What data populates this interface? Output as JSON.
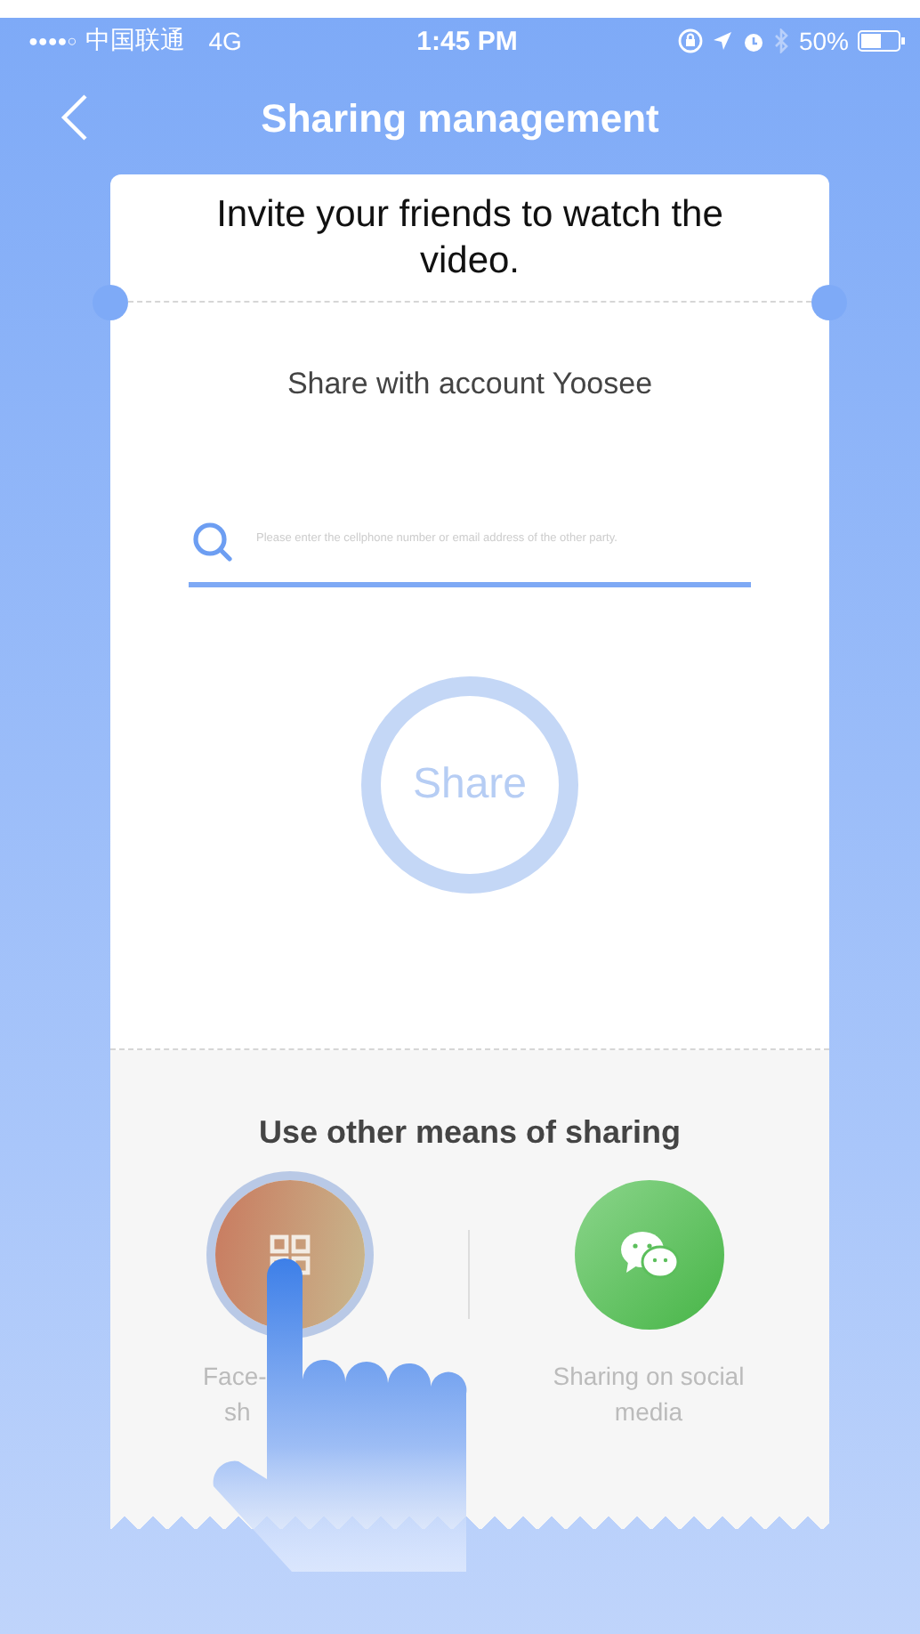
{
  "status_bar": {
    "signal": "●●●●○",
    "carrier": "中国联通",
    "network": "4G",
    "time": "1:45 PM",
    "battery": "50%"
  },
  "nav": {
    "title": "Sharing management"
  },
  "card": {
    "heading": "Invite your friends to watch the video.",
    "subtitle": "Share with account Yoosee",
    "search": {
      "placeholder": "Please enter the cellphone number or email address of the other party."
    },
    "share_button": "Share"
  },
  "other": {
    "title": "Use other means of sharing",
    "options": [
      {
        "kind": "qr",
        "label_lines": [
          "Face-",
          "sh"
        ],
        "selected": true
      },
      {
        "kind": "chat",
        "label_lines": [
          "Sharing on social",
          "media"
        ],
        "selected": false
      }
    ]
  }
}
